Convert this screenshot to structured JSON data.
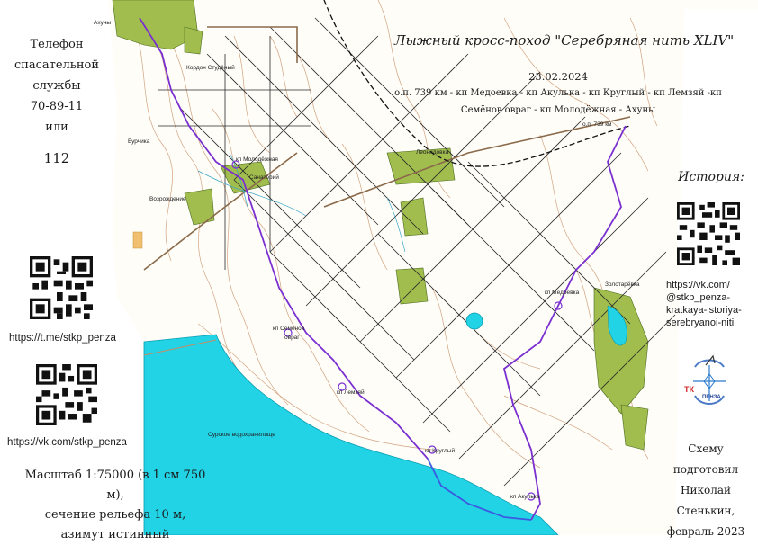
{
  "header": {
    "title": "Лыжный кросс-поход \"Серебряная нить XLIV\"",
    "date": "23.02.2024",
    "route_line1": "о.п. 739 км - кп Медоевка - кп Акулька - кп Круглый - кп Лемзяй -кп",
    "route_line2": "Семёнов овраг - кп Молодёжная - Ахуны"
  },
  "rescue": {
    "lines": [
      "Телефон",
      "спасательной",
      "службы",
      "70-89-11",
      "или"
    ],
    "number": "112"
  },
  "links": {
    "telegram": "https://t.me/stkp_penza",
    "vk": "https://vk.com/stkp_penza"
  },
  "history": {
    "title": "История:",
    "url_lines": [
      "https://vk.com/",
      "@stkp_penza-",
      "kratkaya-istoriya-",
      "serebryanoi-niti"
    ]
  },
  "logo": {
    "text": "ТК",
    "subtext": "ПЕНЗА"
  },
  "scale": {
    "lines": [
      "Масштаб 1:75000 (в 1 см 750 м),",
      "сечение рельефа 10 м,",
      "азимут истинный"
    ]
  },
  "author": {
    "lines": [
      "Схему подготовил",
      "Николай Стенькин,",
      "февраль 2023"
    ]
  },
  "map_labels": {
    "akhuny": "Ахуны",
    "kordon": "Кордон Студёный",
    "burchika": "Бурчика",
    "molodezhnaya": "кп Молодёжная",
    "sanatorii": "Санаторий",
    "vozrozhdenie": "Возрождение",
    "leonidovka": "Леонидовка",
    "op739": "о.п. 739 км",
    "semenov1": "кп Семёнов",
    "semenov2": "овраг",
    "medoevka": "кп Медоевка",
    "zolotarevka": "Золотарёвка",
    "lemzyai": "кп Лемзяй",
    "reservoir": "Сурское водохранилище",
    "krugly": "кп Круглый",
    "akulka": "кп Акулька"
  },
  "colors": {
    "water": "#22d3e6",
    "forest_green": "#9ab84a",
    "route": "#7a2fd0",
    "contour": "#c08a60",
    "road": "#222222"
  }
}
